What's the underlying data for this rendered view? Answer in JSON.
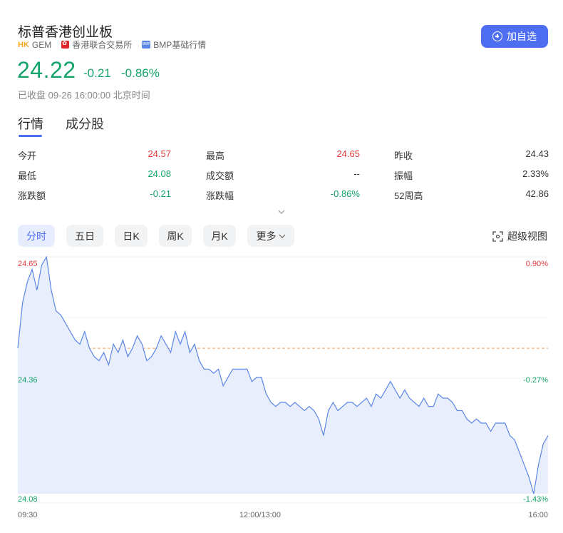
{
  "header": {
    "title": "标普香港创业板",
    "market_code": "GEM",
    "market_code_icon": "HK",
    "exchange": "香港联合交易所",
    "source_icon_text": "BMP",
    "source": "BMP基础行情",
    "add_button": "加自选"
  },
  "quote": {
    "price": "24.22",
    "change": "-0.21",
    "change_pct": "-0.86%",
    "status": "已收盘 09-26 16:00:00 北京时间",
    "color_down": "#14a36a",
    "color_up": "#e33b3b"
  },
  "tabs": [
    {
      "label": "行情",
      "active": true
    },
    {
      "label": "成分股",
      "active": false
    }
  ],
  "stats": [
    {
      "label": "今开",
      "value": "24.57",
      "tone": "red"
    },
    {
      "label": "最高",
      "value": "24.65",
      "tone": "red"
    },
    {
      "label": "昨收",
      "value": "24.43",
      "tone": "dark"
    },
    {
      "label": "最低",
      "value": "24.08",
      "tone": "green"
    },
    {
      "label": "成交额",
      "value": "--",
      "tone": "dark"
    },
    {
      "label": "振幅",
      "value": "2.33%",
      "tone": "dark"
    },
    {
      "label": "涨跌额",
      "value": "-0.21",
      "tone": "green"
    },
    {
      "label": "涨跌幅",
      "value": "-0.86%",
      "tone": "green"
    },
    {
      "label": "52周高",
      "value": "42.86",
      "tone": "dark"
    }
  ],
  "periods": [
    {
      "label": "分时",
      "active": true
    },
    {
      "label": "五日",
      "active": false
    },
    {
      "label": "日K",
      "active": false
    },
    {
      "label": "周K",
      "active": false
    },
    {
      "label": "月K",
      "active": false
    },
    {
      "label": "更多",
      "active": false
    }
  ],
  "super_view": "超级视图",
  "chart_data": {
    "type": "line",
    "title": "",
    "xlabel": "",
    "ylabel": "",
    "x_ticks": [
      "09:30",
      "12:00/13:00",
      "16:00"
    ],
    "y_ticks_left": [
      "24.65",
      "24.36",
      "24.08"
    ],
    "y_ticks_right": [
      "0.90%",
      "-0.27%",
      "-1.43%"
    ],
    "ylim": [
      24.08,
      24.65
    ],
    "prev_close": 24.43,
    "line_color": "#5b86e5",
    "fill_color": "#e9eefc",
    "ref_line_color": "#f0a060",
    "series": [
      {
        "name": "",
        "values": [
          24.43,
          24.54,
          24.59,
          24.62,
          24.57,
          24.63,
          24.65,
          24.57,
          24.52,
          24.51,
          24.49,
          24.47,
          24.45,
          24.44,
          24.47,
          24.43,
          24.41,
          24.4,
          24.42,
          24.39,
          24.44,
          24.42,
          24.45,
          24.41,
          24.43,
          24.46,
          24.44,
          24.4,
          24.41,
          24.43,
          24.46,
          24.44,
          24.42,
          24.47,
          24.44,
          24.47,
          24.42,
          24.44,
          24.4,
          24.38,
          24.38,
          24.37,
          24.38,
          24.34,
          24.36,
          24.38,
          24.38,
          24.38,
          24.38,
          24.35,
          24.36,
          24.36,
          24.32,
          24.3,
          24.29,
          24.3,
          24.3,
          24.29,
          24.3,
          24.29,
          24.28,
          24.29,
          24.28,
          24.26,
          24.22,
          24.28,
          24.3,
          24.28,
          24.29,
          24.3,
          24.3,
          24.29,
          24.3,
          24.31,
          24.29,
          24.32,
          24.31,
          24.33,
          24.35,
          24.33,
          24.31,
          24.33,
          24.31,
          24.3,
          24.29,
          24.31,
          24.29,
          24.29,
          24.32,
          24.31,
          24.31,
          24.3,
          24.28,
          24.28,
          24.26,
          24.25,
          24.26,
          24.25,
          24.25,
          24.23,
          24.25,
          24.25,
          24.25,
          24.22,
          24.21,
          24.18,
          24.15,
          24.12,
          24.08,
          24.15,
          24.2,
          24.22
        ]
      }
    ]
  }
}
